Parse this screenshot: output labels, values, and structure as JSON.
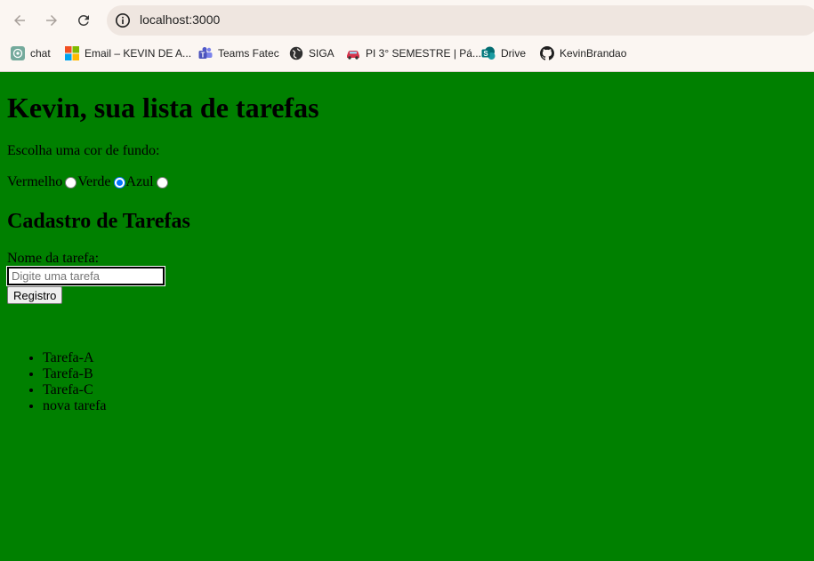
{
  "browser": {
    "url": "localhost:3000",
    "bookmarks": [
      {
        "label": "chat",
        "icon": "chatgpt-icon"
      },
      {
        "label": "Email – KEVIN DE A...",
        "icon": "microsoft-icon"
      },
      {
        "label": "Teams Fatec",
        "icon": "teams-icon"
      },
      {
        "label": "SIGA",
        "icon": "globe-icon"
      },
      {
        "label": "PI 3° SEMESTRE | Pá...",
        "icon": "car-icon"
      },
      {
        "label": "Drive",
        "icon": "sharepoint-icon"
      },
      {
        "label": "KevinBrandao",
        "icon": "github-icon"
      }
    ]
  },
  "page": {
    "title": "Kevin, sua lista de tarefas",
    "color_prompt": "Escolha uma cor de fundo:",
    "color_options": [
      {
        "label": "Vermelho",
        "checked": false
      },
      {
        "label": "Verde",
        "checked": true
      },
      {
        "label": "Azul",
        "checked": false
      }
    ],
    "form_title": "Cadastro de Tarefas",
    "field_label": "Nome da tarefa:",
    "input_placeholder": "Digite uma tarefa",
    "input_value": "",
    "submit_label": "Registro",
    "tasks": [
      "Tarefa-A",
      "Tarefa-B",
      "Tarefa-C",
      "nova tarefa"
    ],
    "background_color": "#008000"
  }
}
